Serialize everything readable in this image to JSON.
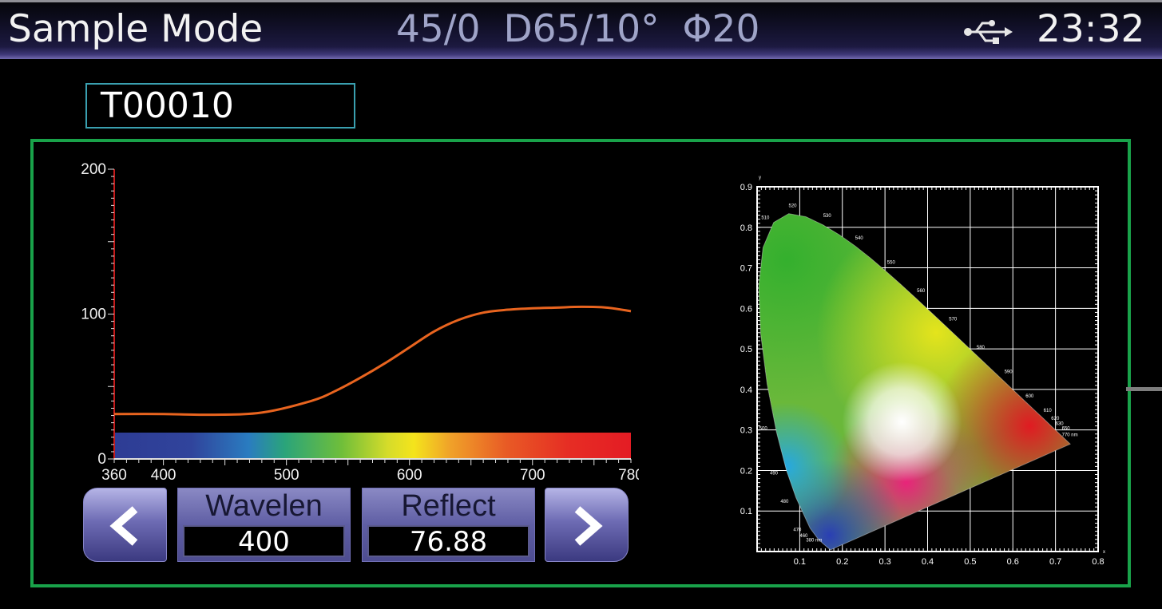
{
  "header": {
    "title": "Sample Mode",
    "conditions": "45/0  D65/10°  Φ20",
    "usb_icon": "usb-icon",
    "time": "23:32"
  },
  "sample": {
    "id": "T00010"
  },
  "readouts": {
    "wavelength_label": "Wavelen",
    "wavelength_value": "400",
    "reflect_label": "Reflect",
    "reflect_value": "76.88"
  },
  "nav": {
    "prev_icon": "chevron-left-icon",
    "next_icon": "chevron-right-icon"
  },
  "colors": {
    "panel_border": "#19a24a",
    "curve": "#e8641f",
    "id_border": "#3aa0b0",
    "button": "#5f5ea4"
  },
  "chart_data": [
    {
      "type": "line",
      "xlim": [
        360,
        780
      ],
      "ylim": [
        0,
        200
      ],
      "x_ticks": [
        "360",
        "400",
        "500",
        "600",
        "700",
        "780"
      ],
      "y_ticks": [
        "200",
        "100",
        "0"
      ],
      "series": [
        {
          "x": [
            360,
            400,
            440,
            480,
            520,
            540,
            560,
            580,
            600,
            620,
            640,
            660,
            680,
            700,
            720,
            740,
            760,
            780
          ],
          "values": [
            31,
            31,
            30.5,
            32,
            40,
            47,
            56,
            66,
            77,
            88,
            96,
            101,
            103,
            104,
            104.5,
            105,
            104.5,
            102
          ]
        }
      ],
      "visible_spectrum_band": true
    },
    {
      "type": "scatter",
      "xlim": [
        0,
        0.8
      ],
      "ylim": [
        0,
        0.9
      ],
      "xlabel": "x",
      "ylabel": "y",
      "x_ticks": [
        "0.1",
        "0.2",
        "0.3",
        "0.4",
        "0.5",
        "0.6",
        "0.7",
        "0.8"
      ],
      "y_ticks": [
        "0.9",
        "0.8",
        "0.7",
        "0.6",
        "0.5",
        "0.4",
        "0.3",
        "0.2",
        "0.1"
      ],
      "grid": true,
      "locus_labels": [
        "520",
        "510",
        "530",
        "540",
        "550",
        "560",
        "570",
        "580",
        "590",
        "600",
        "610",
        "620",
        "630",
        "650",
        "770 nm",
        "500",
        "490",
        "480",
        "470",
        "460",
        "380 nm"
      ]
    }
  ]
}
